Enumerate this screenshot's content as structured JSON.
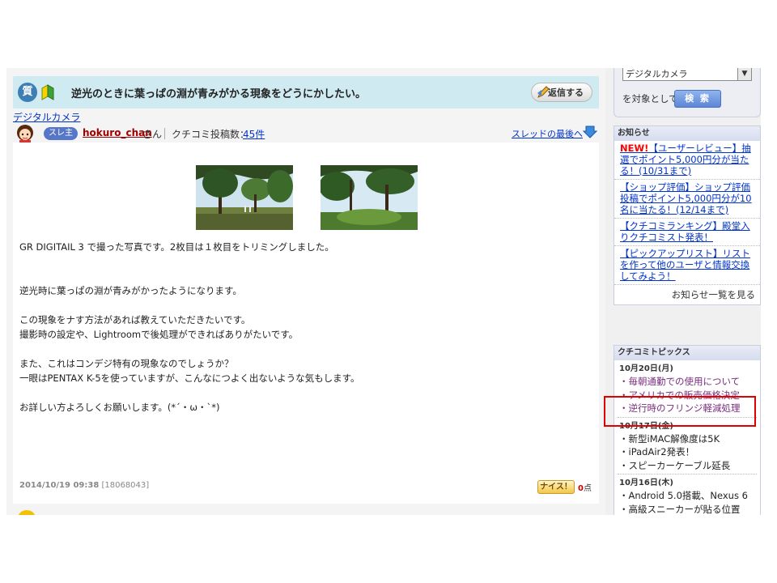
{
  "question": {
    "badge": "質",
    "title": "逆光のときに葉っぱの淵が青みがかる現象をどうにかしたい。",
    "reply_label": "返信する",
    "category": "デジタルカメラ"
  },
  "author": {
    "owner_badge": "スレ主",
    "username": "hokuro_chan",
    "suffix": "さん",
    "post_count_label": "クチコミ投稿数：",
    "post_count": "45件",
    "thread_bottom": "スレッドの最後へ"
  },
  "post": {
    "lines": [
      "GR DIGITAIL 3 で撮った写真です。2枚目は１枚目をトリミングしました。",
      "",
      "",
      "逆光時に葉っぱの淵が青みがかったようになります。",
      "",
      "この現象をナす方法があれば教えていただきたいです。",
      "撮影時の設定や、Lightroomで後処理ができればありがたいです。",
      "",
      "また、これはコンデジ特有の現象なのでしょうか？",
      "一眼はPENTAX K-5を使っていますが、こんなにつよく出ないような気もします。",
      "",
      "お詳しい方よろしくお願いします。(*´・ω・`*)"
    ],
    "date": "2014/10/19 09:38",
    "id": "[18068043]",
    "nice_label": "ナイス！",
    "nice_score": "0",
    "nice_unit": "点"
  },
  "sidebar": {
    "search": {
      "selected": "デジタルカメラ",
      "target_text": "を対象として",
      "button": "検 索"
    },
    "news": {
      "title": "お知らせ",
      "items": [
        {
          "new": "NEW!",
          "text": "【ユーザーレビュー】抽選でポイント5,000円分が当たる！(10/31まで)"
        },
        {
          "new": "",
          "text": "【ショップ評価】ショップ評価投稿でポイント5,000円分が10名に当たる！(12/14まで)"
        },
        {
          "new": "",
          "text": "【クチコミランキング】殿堂入りクチコミスト発表！"
        },
        {
          "new": "",
          "text": "【ピックアップリスト】リストを作って他のユーザと情報交換してみよう！"
        }
      ],
      "more": "お知らせ一覧を見る"
    },
    "topics": {
      "title": "クチコミトピックス",
      "groups": [
        {
          "date": "10月20日(月)",
          "items": [
            "・毎朝通勤での使用について",
            "・アメリカでの販売価格決定",
            "・逆行時のフリンジ軽減処理"
          ]
        },
        {
          "date": "10月17日(金)",
          "items": [
            "・新型iMAC解像度は5K",
            "・iPadAir2発表！",
            "・スピーカーケーブル延長"
          ]
        },
        {
          "date": "10月16日(木)",
          "items": [
            "・Android 5.0搭載、Nexus 6",
            "・高級スニーカーが貼る位置"
          ]
        }
      ]
    }
  },
  "colors": {
    "header_bg": "#cfeaf0",
    "link": "#0033cc",
    "visited": "#7a2c7e",
    "highlight_box": "#e00000"
  }
}
